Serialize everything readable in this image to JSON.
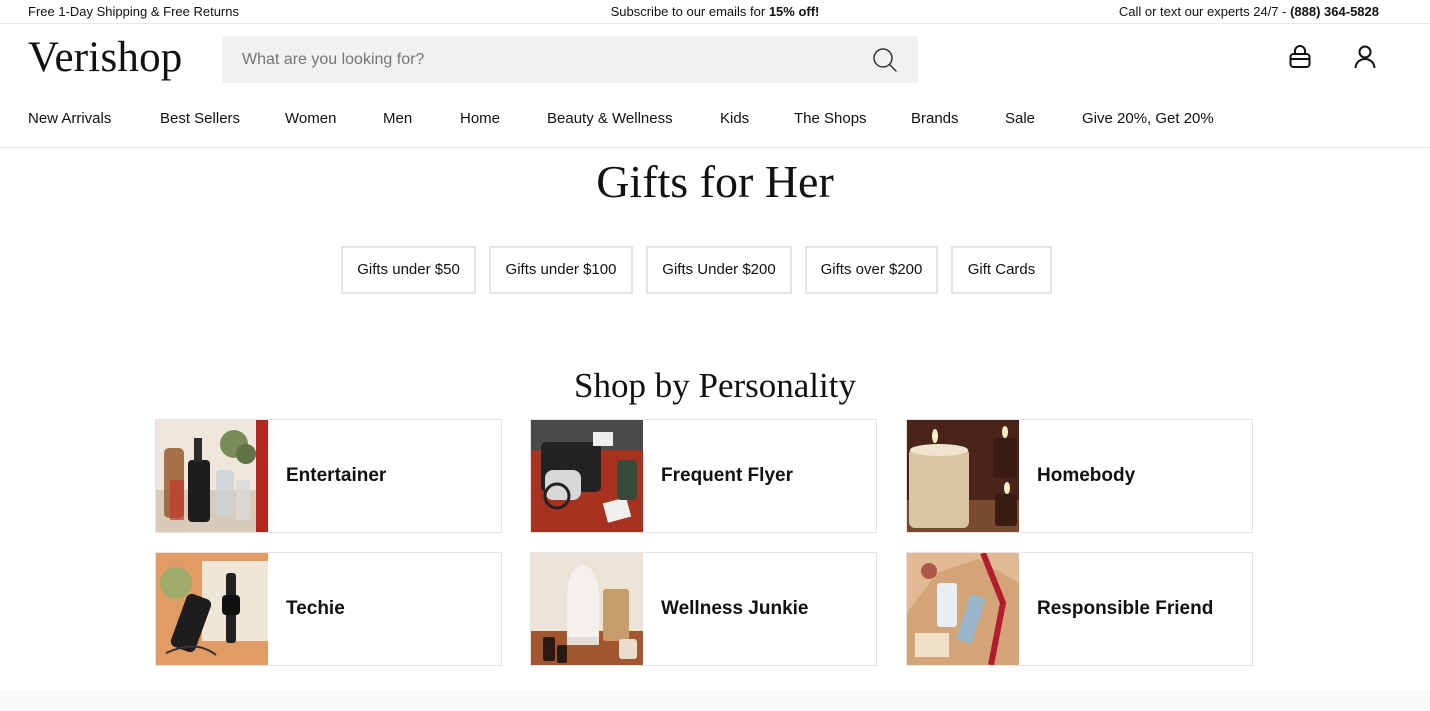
{
  "promo": {
    "left": "Free 1-Day Shipping & Free Returns",
    "center_prefix": "Subscribe to our emails for ",
    "center_bold": "15% off!",
    "right_prefix": "Call or text our experts 24/7 - ",
    "right_bold": "(888) 364-5828"
  },
  "header": {
    "logo": "Verishop",
    "search_placeholder": "What are you looking for?",
    "icons": [
      "search-icon",
      "bag-icon",
      "user-icon"
    ]
  },
  "nav": {
    "items": [
      "New Arrivals",
      "Best Sellers",
      "Women",
      "Men",
      "Home",
      "Beauty & Wellness",
      "Kids",
      "The Shops",
      "Brands",
      "Sale",
      "Give 20%, Get 20%"
    ]
  },
  "page": {
    "title": "Gifts for Her",
    "filters": [
      "Gifts under $50",
      "Gifts under $100",
      "Gifts Under $200",
      "Gifts over $200",
      "Gift Cards"
    ],
    "section_title": "Shop by Personality",
    "personalities": [
      "Entertainer",
      "Frequent Flyer",
      "Homebody",
      "Techie",
      "Wellness Junkie",
      "Responsible Friend"
    ]
  },
  "colors": {
    "text": "#111111",
    "border": "#e3e3e3",
    "search_bg": "#f1f1f1"
  }
}
